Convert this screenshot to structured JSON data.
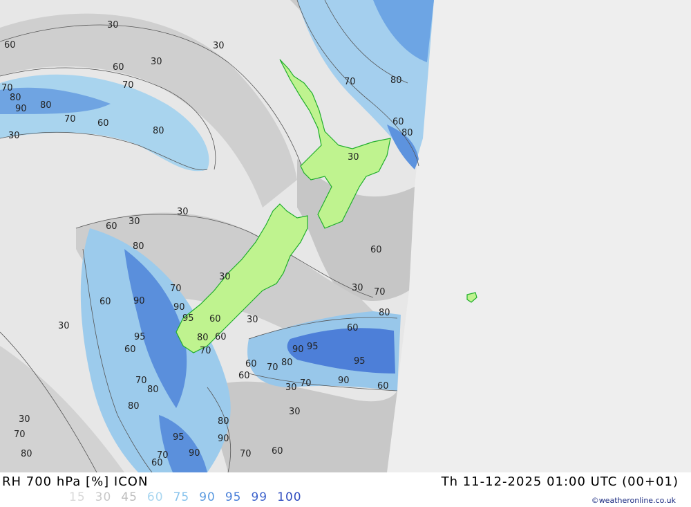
{
  "header": {
    "title": "RH 700 hPa [%] ICON",
    "valid_time": "Th 11-12-2025 01:00 UTC (00+01)"
  },
  "legend": {
    "items": [
      {
        "label": "15",
        "color": "#d8d8d8"
      },
      {
        "label": "30",
        "color": "#c8c8c8"
      },
      {
        "label": "45",
        "color": "#bdbdbd"
      },
      {
        "label": "60",
        "color": "#a9d6f0"
      },
      {
        "label": "75",
        "color": "#86c2ec"
      },
      {
        "label": "90",
        "color": "#5a9ae0"
      },
      {
        "label": "95",
        "color": "#4a7fd8"
      },
      {
        "label": "99",
        "color": "#3d63cc"
      },
      {
        "label": "100",
        "color": "#2f4cbf"
      }
    ]
  },
  "credit": "©weatheronline.co.uk",
  "contour_labels": [
    "30",
    "60",
    "70",
    "80",
    "90",
    "95"
  ],
  "colors": {
    "land_outline": "#1fae2b",
    "land_fill": "#bff38f",
    "no_data": "#efefef"
  }
}
